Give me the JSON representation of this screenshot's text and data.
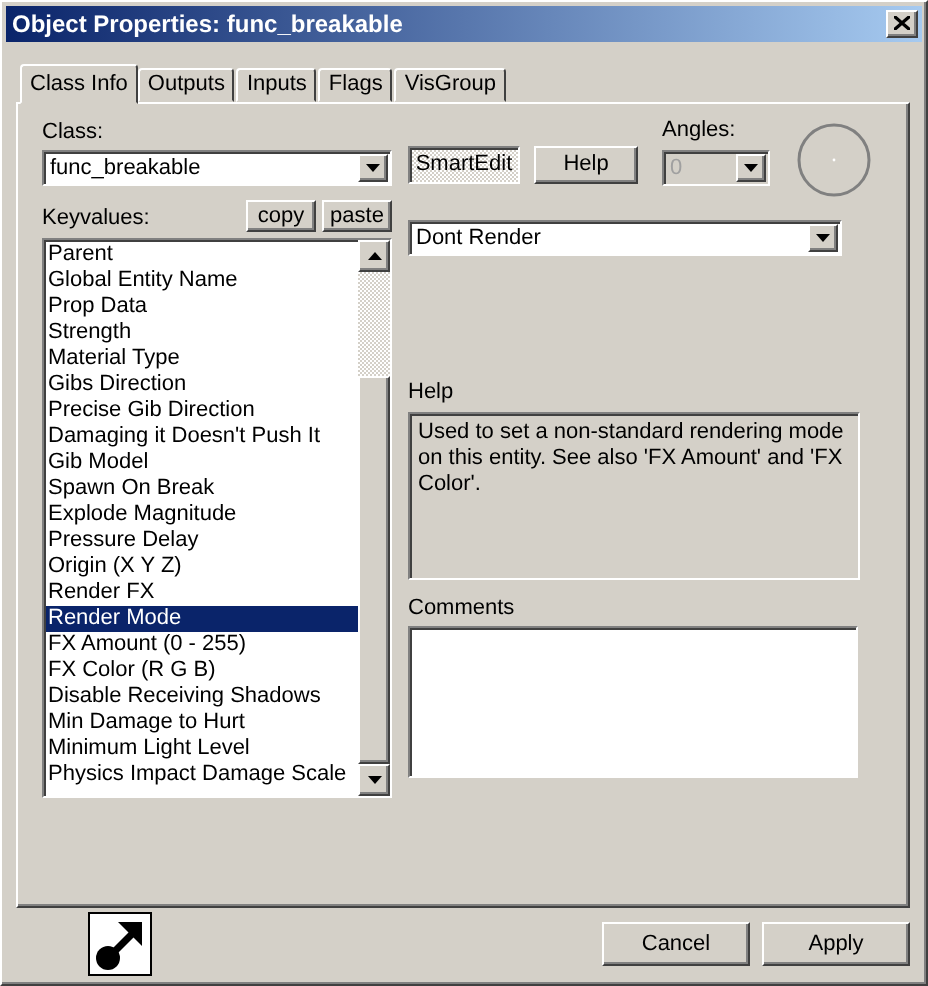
{
  "window": {
    "title": "Object Properties: func_breakable"
  },
  "tabs": [
    {
      "label": "Class Info",
      "selected": true
    },
    {
      "label": "Outputs",
      "selected": false
    },
    {
      "label": "Inputs",
      "selected": false
    },
    {
      "label": "Flags",
      "selected": false
    },
    {
      "label": "VisGroup",
      "selected": false
    }
  ],
  "class": {
    "label": "Class:",
    "value": "func_breakable"
  },
  "smartedit": {
    "label": "SmartEdit",
    "pressed": true
  },
  "help_button": "Help",
  "angles": {
    "label": "Angles:",
    "value": "0",
    "disabled": true
  },
  "keyvalues": {
    "label": "Keyvalues:",
    "buttons": [
      "copy",
      "paste"
    ],
    "items": [
      {
        "label": "Parent",
        "selected": false
      },
      {
        "label": "Global Entity Name",
        "selected": false
      },
      {
        "label": "Prop Data",
        "selected": false
      },
      {
        "label": "Strength",
        "selected": false
      },
      {
        "label": "Material Type",
        "selected": false
      },
      {
        "label": "Gibs Direction",
        "selected": false
      },
      {
        "label": "Precise Gib Direction",
        "selected": false
      },
      {
        "label": "Damaging it Doesn't Push It",
        "selected": false
      },
      {
        "label": "Gib Model",
        "selected": false
      },
      {
        "label": "Spawn On Break",
        "selected": false
      },
      {
        "label": "Explode Magnitude",
        "selected": false
      },
      {
        "label": "Pressure Delay",
        "selected": false
      },
      {
        "label": "Origin (X Y Z)",
        "selected": false
      },
      {
        "label": "Render FX",
        "selected": false
      },
      {
        "label": "Render Mode",
        "selected": true
      },
      {
        "label": "FX Amount (0 - 255)",
        "selected": false
      },
      {
        "label": "FX Color (R G B)",
        "selected": false
      },
      {
        "label": "Disable Receiving Shadows",
        "selected": false
      },
      {
        "label": "Min Damage to Hurt",
        "selected": false
      },
      {
        "label": "Minimum Light Level",
        "selected": false
      },
      {
        "label": "Physics Impact Damage Scale",
        "selected": false
      }
    ]
  },
  "value": "Dont Render",
  "help": {
    "label": "Help",
    "text": "Used to set a non-standard rendering mode on this entity. See also 'FX Amount' and 'FX Color'."
  },
  "comments": {
    "label": "Comments"
  },
  "buttons": [
    "Cancel",
    "Apply"
  ]
}
